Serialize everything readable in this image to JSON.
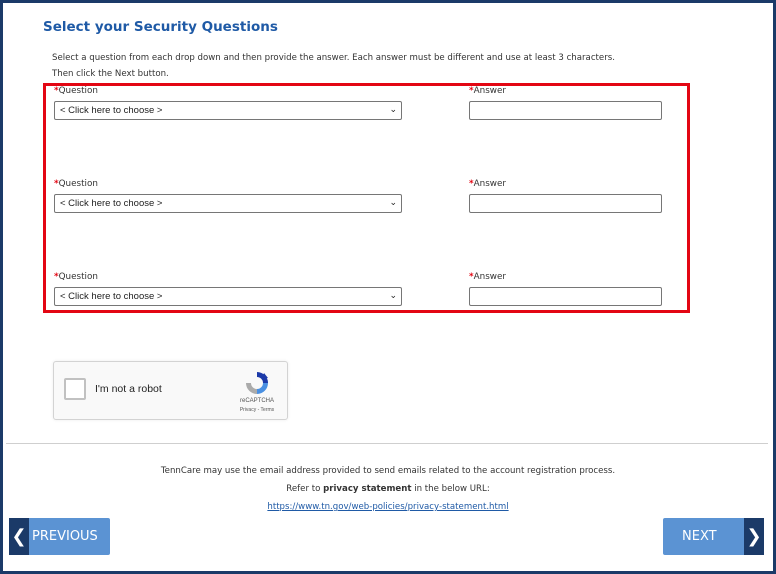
{
  "title": "Select your Security Questions",
  "instructions_line1": "Select a question from each drop down and then provide the answer. Each answer must be different and use at least 3 characters.",
  "instructions_line2": "Then click the Next button.",
  "required_marker": "*",
  "question_label": "Question",
  "answer_label": "Answer",
  "questions": [
    {
      "selected": "< Click here to choose >",
      "answer": ""
    },
    {
      "selected": "< Click here to choose >",
      "answer": ""
    },
    {
      "selected": "< Click here to choose >",
      "answer": ""
    }
  ],
  "captcha": {
    "label": "I'm not a robot",
    "brand": "reCAPTCHA",
    "terms": "Privacy - Terms"
  },
  "footer": {
    "notice": "TennCare may use the email address provided to send emails related to the account registration process.",
    "refer_prefix": "Refer to ",
    "refer_bold": "privacy statement",
    "refer_suffix": " in the below URL:",
    "url": "https://www.tn.gov/web-policies/privacy-statement.html"
  },
  "buttons": {
    "previous": "PREVIOUS",
    "next": "NEXT"
  },
  "colors": {
    "title": "#1f5aa6",
    "highlight": "#e30613",
    "button": "#5b93d3",
    "button_arrow": "#1b3a68",
    "frame": "#1b3a68"
  }
}
